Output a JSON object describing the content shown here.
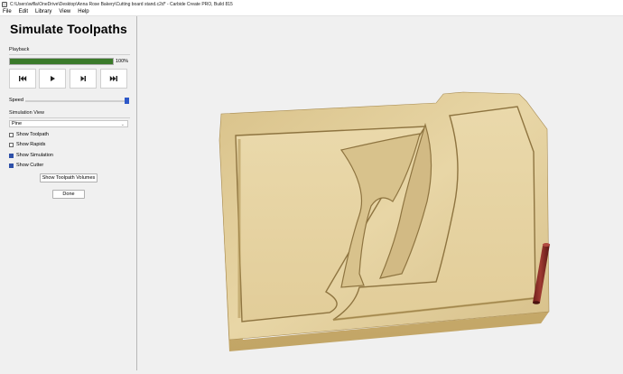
{
  "window": {
    "title": "C:\\Users\\wlfla\\OneDrive\\Desktop\\Anna Rose Bakery\\Cutting board stand.c2d* - Carbide Create PRO, Build 815"
  },
  "menu": {
    "items": [
      {
        "label": "File"
      },
      {
        "label": "Edit"
      },
      {
        "label": "Library"
      },
      {
        "label": "View"
      },
      {
        "label": "Help"
      }
    ]
  },
  "panel": {
    "title": "Simulate Toolpaths",
    "playback": {
      "label": "Playback",
      "progress_fraction": 1.0,
      "progress_text": "100%",
      "buttons": [
        {
          "name": "rewind-button",
          "icon": "skip-back-icon"
        },
        {
          "name": "play-button",
          "icon": "play-icon"
        },
        {
          "name": "step-button",
          "icon": "step-forward-icon"
        },
        {
          "name": "end-button",
          "icon": "skip-forward-icon"
        }
      ]
    },
    "speed": {
      "label": "Speed",
      "value_fraction": 1.0
    },
    "simulation_view": {
      "label": "Simulation View",
      "selected": "Pine"
    },
    "checkboxes": [
      {
        "label": "Show Toolpath",
        "checked": false
      },
      {
        "label": "Show Rapids",
        "checked": false
      },
      {
        "label": "Show Simulation",
        "checked": true
      },
      {
        "label": "Show Cutter",
        "checked": true
      }
    ],
    "volumes_button": "Show Toolpath Volumes",
    "done_button": "Done"
  },
  "colors": {
    "progress": "#3a7a2a",
    "accent": "#2e58c8",
    "wood_light": "#e6d29e",
    "wood_mid": "#c9ad6c",
    "wood_dark": "#9e8448",
    "cutter": "#8a2a24"
  }
}
